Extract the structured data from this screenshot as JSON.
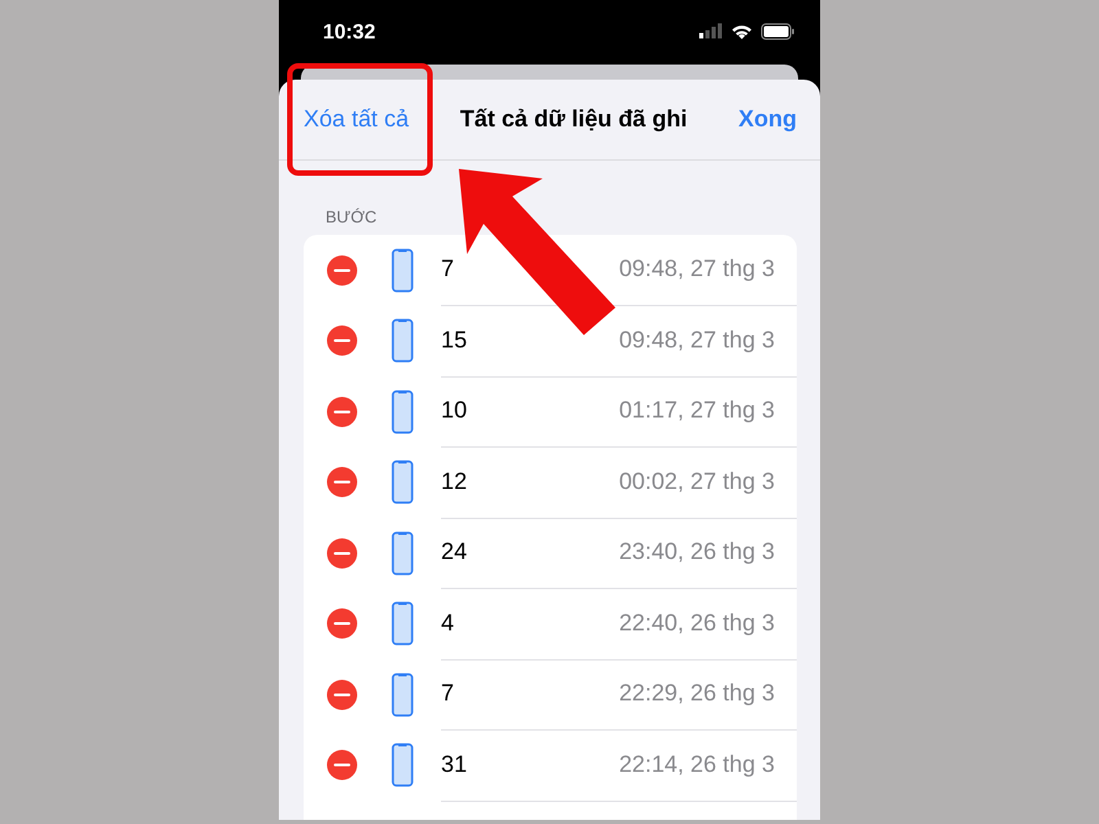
{
  "status_bar": {
    "time": "10:32"
  },
  "sheet": {
    "left_action": "Xóa tất cả",
    "title": "Tất cả dữ liệu đã ghi",
    "right_action": "Xong"
  },
  "section_header": "BƯỚC",
  "entries": [
    {
      "value": "7",
      "time": "09:48, 27 thg 3"
    },
    {
      "value": "15",
      "time": "09:48, 27 thg 3"
    },
    {
      "value": "10",
      "time": "01:17, 27 thg 3"
    },
    {
      "value": "12",
      "time": "00:02, 27 thg 3"
    },
    {
      "value": "24",
      "time": "23:40, 26 thg 3"
    },
    {
      "value": "4",
      "time": "22:40, 26 thg 3"
    },
    {
      "value": "7",
      "time": "22:29, 26 thg 3"
    },
    {
      "value": "31",
      "time": "22:14, 26 thg 3"
    }
  ]
}
